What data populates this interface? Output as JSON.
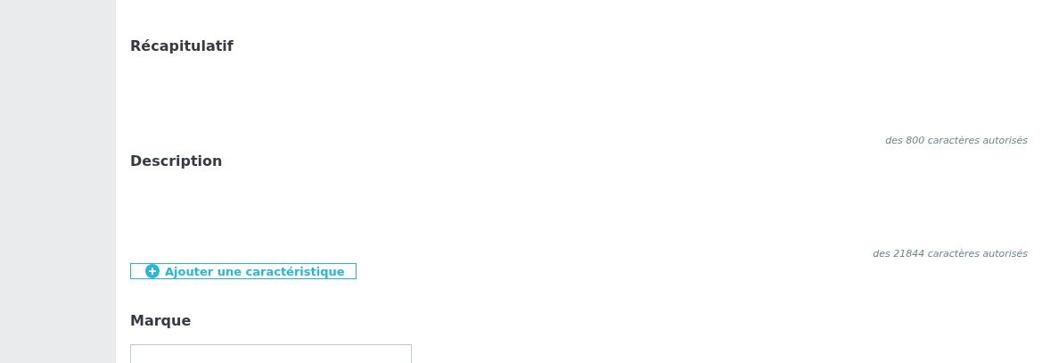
{
  "sections": [
    {
      "title": "Récapitulatif",
      "counter": "des 800 caractères autorisés"
    },
    {
      "title": "Description",
      "counter": "des 21844 caractères autorisés"
    }
  ],
  "add_button": {
    "label": "Ajouter une caractéristique"
  },
  "brand": {
    "title": "Marque"
  }
}
